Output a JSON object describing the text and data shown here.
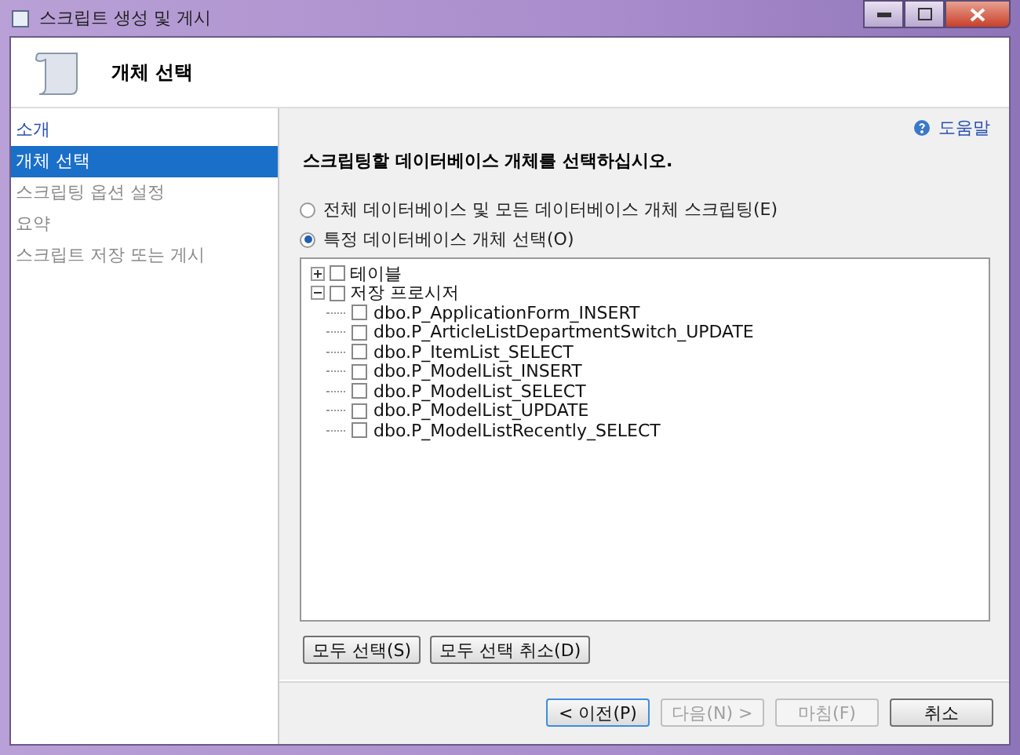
{
  "window": {
    "title": "스크립트 생성 및 게시"
  },
  "header": {
    "title": "개체 선택"
  },
  "nav": [
    {
      "label": "소개",
      "selected": false,
      "disabled": false
    },
    {
      "label": "개체 선택",
      "selected": true,
      "disabled": false
    },
    {
      "label": "스크립팅 옵션 설정",
      "selected": false,
      "disabled": true
    },
    {
      "label": "요약",
      "selected": false,
      "disabled": true
    },
    {
      "label": "스크립트 저장 또는 게시",
      "selected": false,
      "disabled": true
    }
  ],
  "help": "도움말",
  "instruction": "스크립팅할 데이터베이스 개체를 선택하십시오.",
  "options": [
    {
      "label": "전체 데이터베이스 및 모든 데이터베이스 개체 스크립팅(E)",
      "selected": false
    },
    {
      "label": "특정 데이터베이스 개체 선택(O)",
      "selected": true
    }
  ],
  "tree": [
    {
      "label": "테이블",
      "expanded": false,
      "checked": false
    },
    {
      "label": "저장 프로시저",
      "expanded": true,
      "checked": false,
      "children": [
        {
          "label": "dbo.P_ApplicationForm_INSERT",
          "checked": false
        },
        {
          "label": "dbo.P_ArticleListDepartmentSwitch_UPDATE",
          "checked": false
        },
        {
          "label": "dbo.P_ItemList_SELECT",
          "checked": false
        },
        {
          "label": "dbo.P_ModelList_INSERT",
          "checked": false
        },
        {
          "label": "dbo.P_ModelList_SELECT",
          "checked": false
        },
        {
          "label": "dbo.P_ModelList_UPDATE",
          "checked": false
        },
        {
          "label": "dbo.P_ModelListRecently_SELECT",
          "checked": false
        }
      ]
    }
  ],
  "select_buttons": [
    {
      "label": "모두 선택(S)"
    },
    {
      "label": "모두 선택 취소(D)"
    }
  ],
  "footer_buttons": [
    {
      "label": "< 이전(P)",
      "disabled": false,
      "selected": true
    },
    {
      "label": "다음(N) >",
      "disabled": true,
      "selected": false
    },
    {
      "label": "마침(F)",
      "disabled": true,
      "selected": false
    },
    {
      "label": "취소",
      "disabled": false,
      "selected": false
    }
  ]
}
